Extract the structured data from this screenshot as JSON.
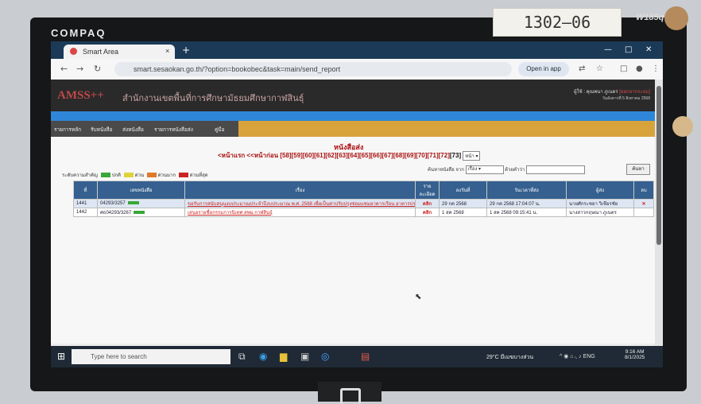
{
  "monitor": {
    "brand": "COMPAQ",
    "sticker": "1302—06",
    "model": "W185q"
  },
  "browser": {
    "tab_title": "Smart Area",
    "tab_close": "×",
    "new_tab": "+",
    "url": "smart.sesaokan.go.th/?option=bookobec&task=main/send_report",
    "open_in_app": "Open in app",
    "window_controls": [
      "—",
      "□",
      "✕"
    ]
  },
  "header": {
    "logo": "AMSS++",
    "org": "สำนักงานเขตพื้นที่การศึกษามัธยมศึกษากาฬสินธุ์",
    "user_label": "ผู้ใช้ : คุณพนา ภูเนตร",
    "user_role": "[ออกจากระบบ]",
    "date": "วันอังคารที่ 5 สิงหาคม 2568"
  },
  "menu": {
    "items": [
      "รายการหลัก",
      "รับหนังสือ",
      "ส่งหนังสือ",
      "รายการหนังสือส่ง",
      "คู่มือ"
    ]
  },
  "content": {
    "title": "หนังสือส่ง",
    "pages_prefix": "<หน้าแรก <<หน้าก่อน",
    "pages": [
      "[58]",
      "[59]",
      "[60]",
      "[61]",
      "[62]",
      "[63]",
      "[64]",
      "[65]",
      "[66]",
      "[67]",
      "[68]",
      "[69]",
      "[70]",
      "[71]",
      "[72]"
    ],
    "current_page": "[73]",
    "page_select": "หน้า",
    "legend_prefix": "ระดับความสำคัญ",
    "legend": [
      {
        "label": "ปกติ",
        "color": "#38a838"
      },
      {
        "label": "ด่วน",
        "color": "#e0d33a"
      },
      {
        "label": "ด่วนมาก",
        "color": "#e07a2a"
      },
      {
        "label": "ด่วนที่สุด",
        "color": "#cc2222"
      }
    ],
    "search": {
      "label": "ค้นหาหนังสือ จาก",
      "field": "เรื่อง",
      "by_label": "ด้วยคำว่า",
      "button": "ค้นหา"
    }
  },
  "table": {
    "headers": [
      "ที่",
      "เลขหนังสือ",
      "เรื่อง",
      "รายละเอียด",
      "ลงวันที่",
      "วันเวลาที่ส่ง",
      "ผู้ส่ง",
      "ลบ"
    ],
    "rows": [
      {
        "no": "1441",
        "doc_no": "04293/3257",
        "subject": "ขอรับการสนับสนุนงบประมาณประจำปีงบประมาณ พ.ศ. 2568 เพื่อเป็นค่าปรับปรุงซ่อมแซมอาคารเรียน อาคารประกอบและสิ่งก่อสร้างอื่น",
        "detail": "คลิก",
        "date": "29 กค 2568",
        "sent": "29 กค 2568 17:04:07 น.",
        "sender": "นายศักระชยา วิเชียรชัย",
        "delete": "✕"
      },
      {
        "no": "1442",
        "doc_no": "ศธ04293/3267",
        "subject": "เสนอรายชื่อกรรมการนิเทศ สพม.กาฬสินธุ์",
        "detail": "คลิก",
        "date": "1 สค 2568",
        "sent": "1 สค 2568 09:15:41 น.",
        "sender": "นางสาวกฤษณา ภูเนตร",
        "delete": ""
      }
    ]
  },
  "taskbar": {
    "search_placeholder": "Type here to search",
    "weather": "29°C มีเมฆบางส่วน",
    "lang": "ENG",
    "time": "9:16 AM",
    "date": "8/1/2025"
  }
}
